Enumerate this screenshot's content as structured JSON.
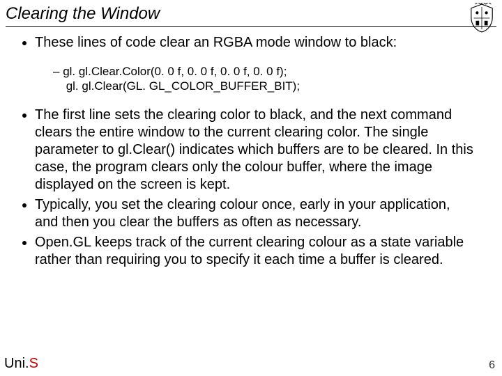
{
  "title": "Clearing the Window",
  "logo_name": "university-crest",
  "bullets": [
    {
      "text": "These lines of code clear an RGBA mode window to black:",
      "sub": [
        {
          "line1": "gl. gl.Clear.Color(0. 0 f, 0. 0 f, 0. 0 f, 0. 0 f);",
          "line2": "gl. gl.Clear(GL. GL_COLOR_BUFFER_BIT);"
        }
      ]
    },
    {
      "text": "The first line sets the clearing color to black, and the next command clears the entire window to the current clearing color. The single parameter to gl.Clear() indicates which buffers are to be cleared. In this case, the program clears only the colour buffer, where the image displayed on the screen is kept."
    },
    {
      "text": "Typically, you set the clearing colour once, early in your application, and then you clear the buffers as often as necessary."
    },
    {
      "text": "Open.GL keeps track of the current clearing colour as a state variable rather than requiring you to specify it each time a buffer is cleared."
    }
  ],
  "footer": {
    "org_part1": "Uni.",
    "org_part2": "S",
    "page_number": "6"
  }
}
